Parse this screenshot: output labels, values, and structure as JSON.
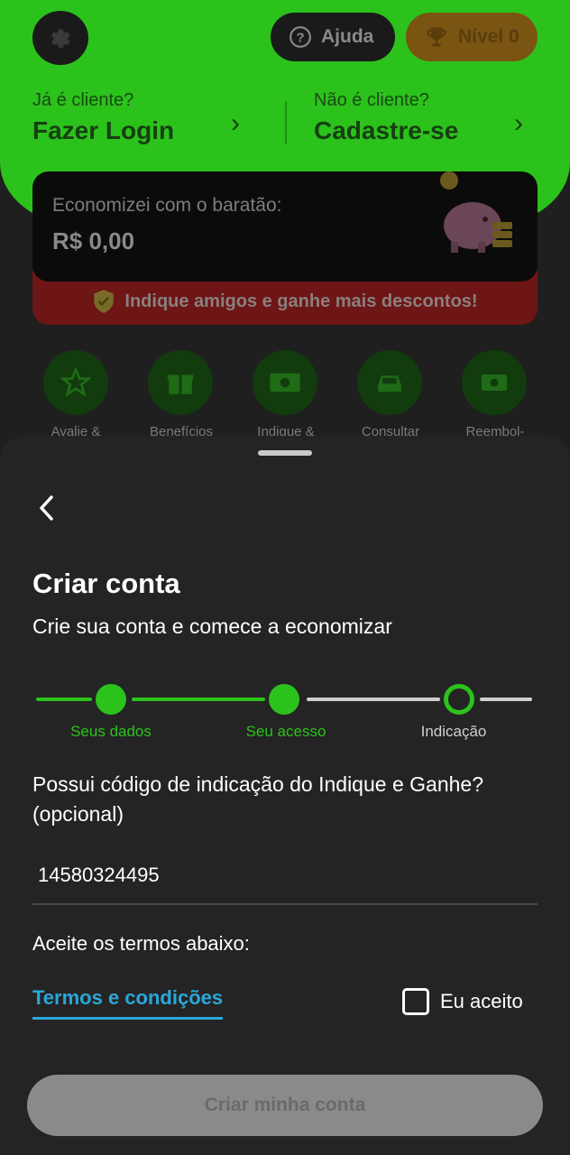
{
  "header": {
    "help_label": "Ajuda",
    "level_label": "Nível 0",
    "login_question": "Já é cliente?",
    "login_action": "Fazer Login",
    "signup_question": "Não é cliente?",
    "signup_action": "Cadastre-se"
  },
  "savings": {
    "label": "Economizei com o baratão:",
    "amount": "R$ 0,00"
  },
  "referral_banner": "Indique amigos e ganhe mais descontos!",
  "shortcuts": [
    {
      "label": "Avalie &",
      "icon": "star-icon"
    },
    {
      "label": "Benefícios",
      "icon": "gift-icon"
    },
    {
      "label": "Indique &",
      "icon": "money-icon"
    },
    {
      "label": "Consultar",
      "icon": "car-icon"
    },
    {
      "label": "Reembol-",
      "icon": "refund-icon"
    }
  ],
  "sheet": {
    "title": "Criar conta",
    "subtitle": "Crie sua conta e comece a economizar",
    "steps": [
      {
        "label": "Seus dados",
        "state": "done"
      },
      {
        "label": "Seu acesso",
        "state": "done"
      },
      {
        "label": "Indicação",
        "state": "current"
      }
    ],
    "question": "Possui código de indicação do Indique e Ganhe? (opcional)",
    "code_value": "14580324495",
    "terms_heading": "Aceite os termos abaixo:",
    "terms_link": "Termos e condições",
    "accept_label": "Eu aceito",
    "submit_label": "Criar minha conta"
  },
  "colors": {
    "brand_green": "#2bc21c",
    "link_blue": "#2aa7d9",
    "level_orange": "#e7a31a"
  }
}
